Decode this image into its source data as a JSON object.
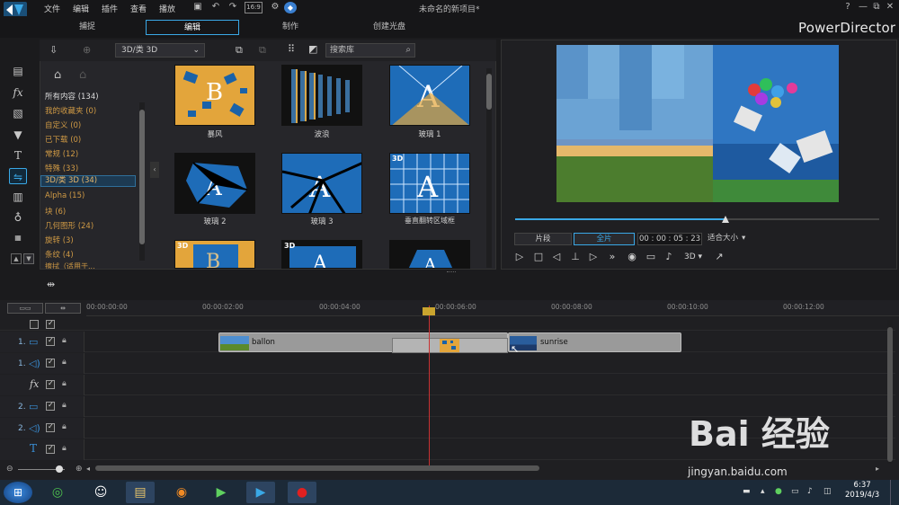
{
  "menu": [
    "文件",
    "编辑",
    "插件",
    "查看",
    "播放"
  ],
  "document_title": "未命名的新项目*",
  "window_buttons": [
    "?",
    "—",
    "⧉",
    "✕"
  ],
  "mode_tabs": [
    "捕捉",
    "编辑",
    "制作",
    "创建光盘"
  ],
  "active_mode_tab": "编辑",
  "brand": "PowerDirector",
  "library": {
    "filter_value": "3D/类 3D",
    "search_placeholder": "搜索库",
    "categories": [
      {
        "label": "所有内容 (134)",
        "style": "white"
      },
      {
        "label": "我的收藏夹 (0)"
      },
      {
        "label": "自定义 (0)"
      },
      {
        "label": "已下载 (0)"
      },
      {
        "label": "常规 (12)"
      },
      {
        "label": "特殊 (33)"
      },
      {
        "label": "3D/类 3D (34)",
        "active": true
      },
      {
        "label": "Alpha (15)"
      },
      {
        "label": "块 (6)"
      },
      {
        "label": "几何图形 (24)"
      },
      {
        "label": "旋转 (3)"
      },
      {
        "label": "条纹 (4)"
      },
      {
        "label": "擦拭（适用于..."
      }
    ],
    "thumbnails": [
      {
        "label": "暴风",
        "badge": ""
      },
      {
        "label": "波浪",
        "badge": ""
      },
      {
        "label": "玻璃 1",
        "badge": ""
      },
      {
        "label": "玻璃 2",
        "badge": ""
      },
      {
        "label": "玻璃 3",
        "badge": ""
      },
      {
        "label": "垂直翻转区域框",
        "badge": "3D"
      },
      {
        "label": "",
        "badge": "3D"
      },
      {
        "label": "",
        "badge": "3D"
      },
      {
        "label": "",
        "badge": ""
      }
    ]
  },
  "preview": {
    "progress_percent": 58,
    "clip_button": "片段",
    "full_button": "全片",
    "timecode": "00 : 00 : 05 : 23",
    "fit_select": "适合大小",
    "mode_3d": "3D"
  },
  "timeline": {
    "ruler": [
      "00:00:00:00",
      "00:00:02:00",
      "00:00:04:00",
      "00:00:06:00",
      "00:00:08:00",
      "00:00:10:00",
      "00:00:12:00"
    ],
    "tracks": [
      {
        "num": "1.",
        "kind": "video"
      },
      {
        "num": "1.",
        "kind": "audio"
      },
      {
        "num": "",
        "kind": "fx"
      },
      {
        "num": "2.",
        "kind": "video"
      },
      {
        "num": "2.",
        "kind": "audio"
      },
      {
        "num": "",
        "kind": "title"
      }
    ],
    "clips": [
      {
        "name": "ballon"
      },
      {
        "name": "sunrise"
      }
    ]
  },
  "taskbar": {
    "time": "6:37",
    "date": "2019/4/3"
  },
  "watermark": {
    "text": "Bai 经验",
    "url": "jingyan.baidu.com"
  }
}
